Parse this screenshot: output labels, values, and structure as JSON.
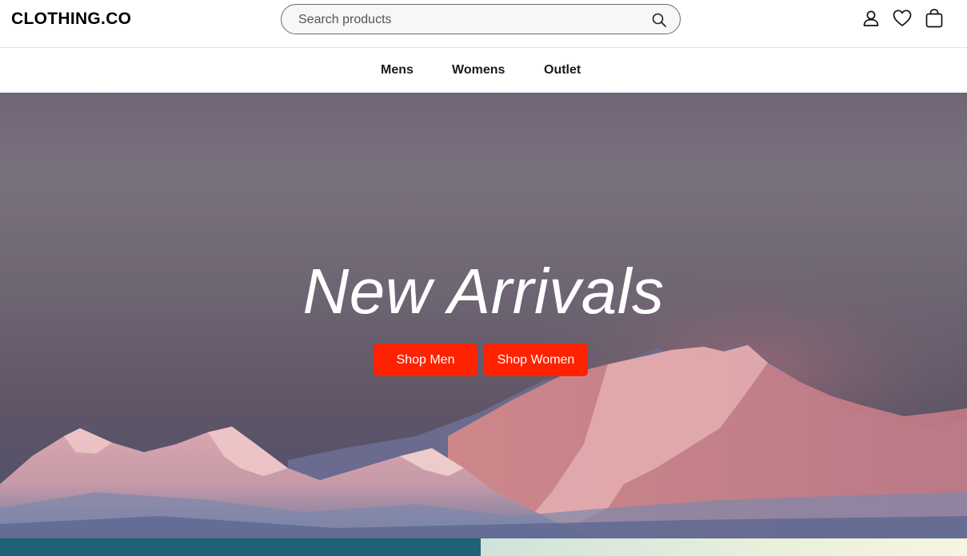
{
  "header": {
    "logo": "CLOTHING.CO",
    "search_placeholder": "Search products",
    "icons": [
      "user-icon",
      "heart-icon",
      "bag-icon"
    ]
  },
  "nav": {
    "items": [
      {
        "label": "Mens"
      },
      {
        "label": "Womens"
      },
      {
        "label": "Outlet"
      }
    ]
  },
  "hero": {
    "title": "New Arrivals",
    "buttons": [
      {
        "label": "Shop Men"
      },
      {
        "label": "Shop Women"
      }
    ]
  },
  "colors": {
    "accent": "#ff2200",
    "strip_left": "#1f6275",
    "strip_right": "#e9f0dc"
  }
}
